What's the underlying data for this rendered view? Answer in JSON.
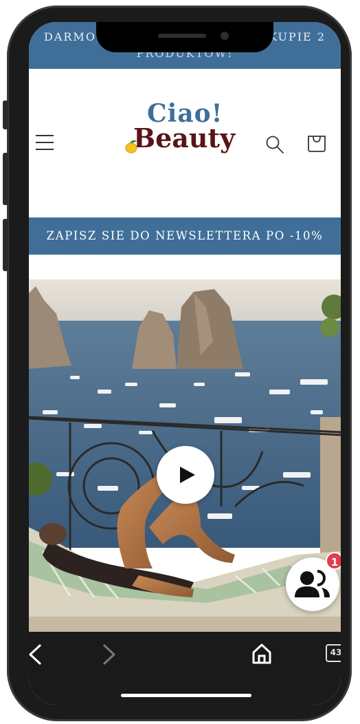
{
  "announcement": {
    "line1_left": "DARMO",
    "line1_right": "KUPIE 2",
    "line2": "PRODUKTÓW!"
  },
  "logo": {
    "top_word": "Ciao!",
    "bottom_word": "Beauty"
  },
  "header": {
    "menu_icon": "hamburger-menu-icon",
    "search_icon": "search-icon",
    "cart_icon": "shopping-bag-icon"
  },
  "newsletter_banner": {
    "text": "ZAPISZ SIE DO NEWSLETTERA PO -10%"
  },
  "hero": {
    "play_icon": "play-icon",
    "community_icon": "people-icon",
    "community_badge": "1"
  },
  "browser": {
    "back_icon": "chevron-left-icon",
    "forward_icon": "chevron-right-icon",
    "home_icon": "home-icon",
    "tab_count": "43"
  },
  "colors": {
    "brand_blue": "#3f6f98",
    "brand_burgundy": "#5a1418",
    "badge_red": "#e23c4d",
    "browser_bar": "#1a1a1a"
  }
}
